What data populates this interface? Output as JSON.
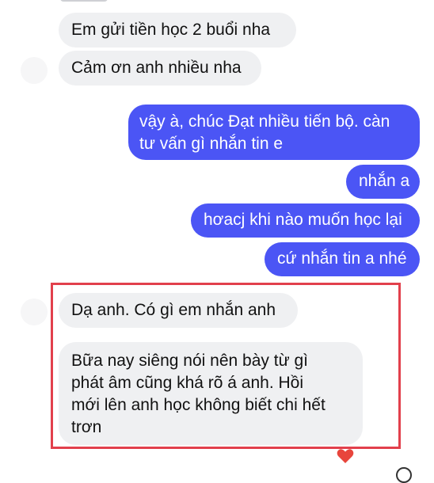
{
  "messages": {
    "m1": "Em gửi tiền học 2 buổi nha",
    "m2": "Cảm ơn anh nhiều nha",
    "m3_line1": "vậy à, chúc Đạt nhiều tiến bộ. càn",
    "m3_line2": "tư vấn gì nhắn tin e",
    "m4": "nhắn a",
    "m5": "hơacj khi nào muốn học lại",
    "m6": "cứ nhắn tin a nhé",
    "m7": "Dạ anh. Có gì em nhắn anh",
    "m8_line1": "Bữa nay siêng nói nên bày từ gì",
    "m8_line2": "phát âm cũng khá rõ á anh. Hồi",
    "m8_line3": "mới lên anh học không biết chi hết",
    "m8_line4": "trơn"
  },
  "colors": {
    "outgoing_bubble": "#4b55f5",
    "incoming_bubble": "#eff0f2",
    "highlight_border": "#e2404c",
    "reaction_heart": "#e8453c"
  },
  "icons": {
    "reaction": "heart-icon"
  }
}
